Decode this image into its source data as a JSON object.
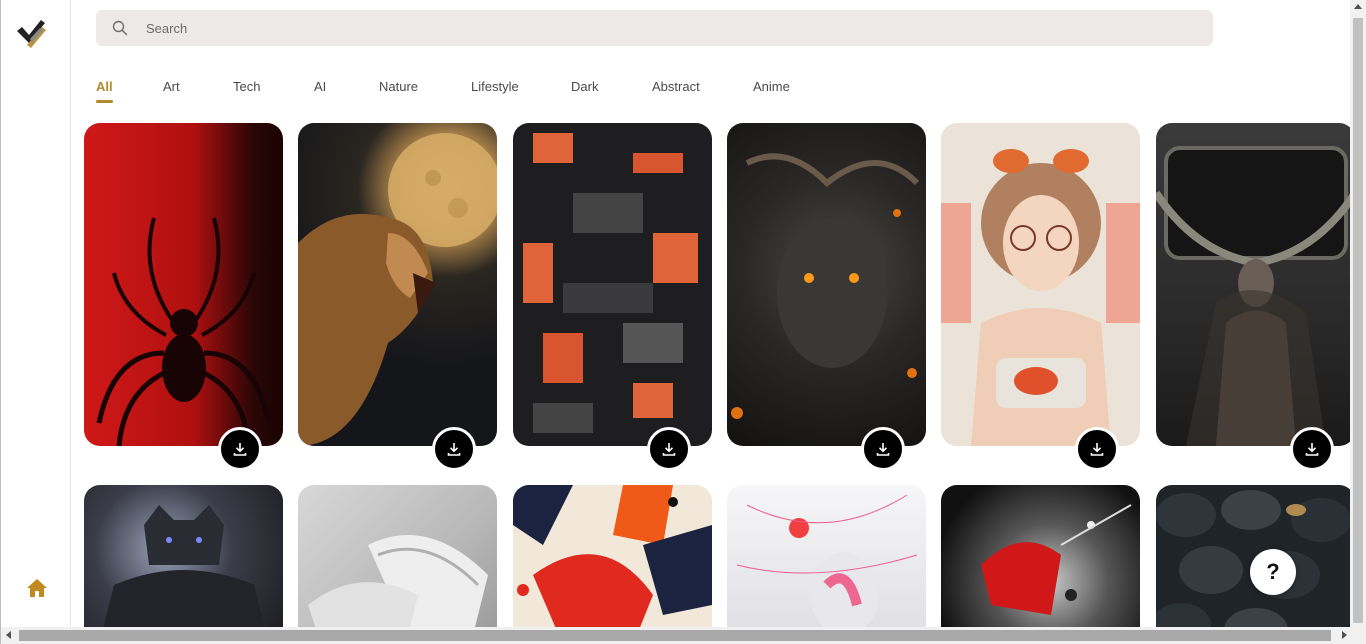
{
  "search": {
    "placeholder": "Search",
    "value": ""
  },
  "tabs": [
    {
      "label": "All",
      "active": true
    },
    {
      "label": "Art",
      "active": false
    },
    {
      "label": "Tech",
      "active": false
    },
    {
      "label": "AI",
      "active": false
    },
    {
      "label": "Nature",
      "active": false
    },
    {
      "label": "Lifestyle",
      "active": false
    },
    {
      "label": "Dark",
      "active": false
    },
    {
      "label": "Abstract",
      "active": false
    },
    {
      "label": "Anime",
      "active": false
    }
  ],
  "wallpapers_row1": [
    {
      "subject": "red spider",
      "icon": "download-icon"
    },
    {
      "subject": "lion and moon",
      "icon": "download-icon"
    },
    {
      "subject": "orange tech blocks",
      "icon": "download-icon"
    },
    {
      "subject": "dark warrior face",
      "icon": "download-icon"
    },
    {
      "subject": "anime girl with goggles",
      "icon": "download-icon"
    },
    {
      "subject": "woman in dark frame",
      "icon": "download-icon"
    }
  ],
  "wallpapers_row2": [
    {
      "subject": "armored knight"
    },
    {
      "subject": "white sneakers"
    },
    {
      "subject": "red orange abstract"
    },
    {
      "subject": "pink ink sculpture"
    },
    {
      "subject": "red splash"
    },
    {
      "subject": "black pebbles"
    }
  ],
  "help": {
    "label": "?"
  },
  "colors": {
    "accent": "#b08a2f",
    "search_bg": "#ece9e7"
  }
}
